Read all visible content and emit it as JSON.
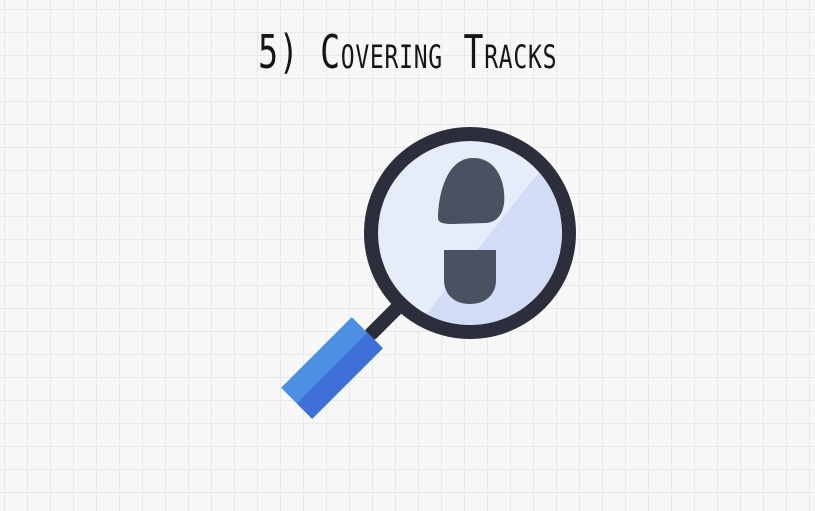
{
  "slide": {
    "title": "5) Covering Tracks",
    "illustration_icon": "magnifying-glass-footprint-icon"
  },
  "colors": {
    "background": "#f7f7f7",
    "grid_lines": "#e8e8e8",
    "title_text": "#161616",
    "lens_rim": "#2c2f3b",
    "lens_glass": "#e6ecfa",
    "lens_glare": "#d3dcf7",
    "footprint": "#4a5262",
    "handle": "#4d8fe3",
    "handle_shade": "#3f6fd8",
    "connector": "#2c2f3b"
  }
}
